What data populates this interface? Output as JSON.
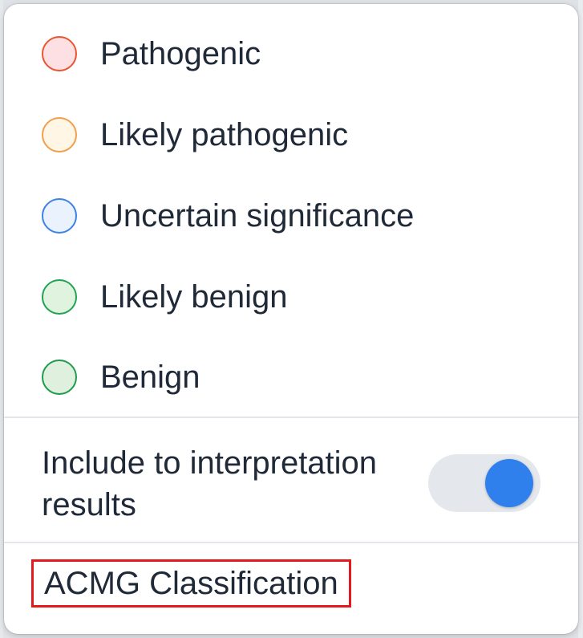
{
  "options": [
    {
      "label": "Pathogenic",
      "icon": "radio-circle-icon",
      "fill": "#fde0e3",
      "stroke": "#e8552f"
    },
    {
      "label": "Likely pathogenic",
      "icon": "radio-circle-icon",
      "fill": "#fff6e6",
      "stroke": "#f0a04b"
    },
    {
      "label": "Uncertain significance",
      "icon": "radio-circle-icon",
      "fill": "#eaf2fd",
      "stroke": "#3d83e6"
    },
    {
      "label": "Likely benign",
      "icon": "radio-circle-icon",
      "fill": "#dff3df",
      "stroke": "#22a352"
    },
    {
      "label": "Benign",
      "icon": "radio-circle-icon",
      "fill": "#dff0df",
      "stroke": "#1f9a4e"
    }
  ],
  "include": {
    "label": "Include to interpretation results",
    "toggle_on": true,
    "toggle_knob_color": "#2f80ed",
    "toggle_track_color": "#e4e7ec"
  },
  "acmg": {
    "label": "ACMG Classification",
    "highlight_color": "#e3191c"
  }
}
